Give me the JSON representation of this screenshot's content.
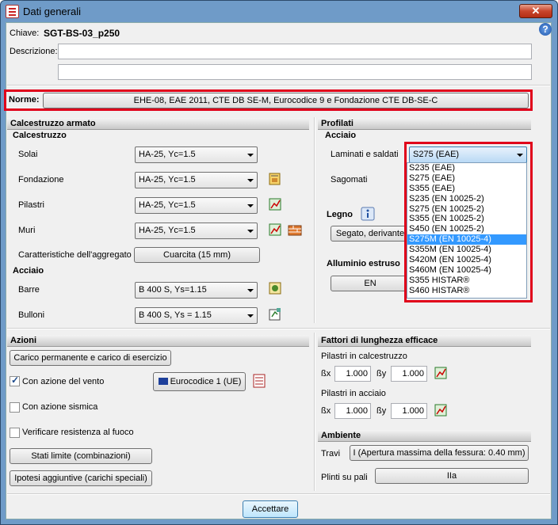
{
  "window": {
    "title": "Dati generali",
    "close": "✕"
  },
  "header": {
    "chiave_label": "Chiave:",
    "chiave_value": "SGT-BS-03_p250",
    "descrizione_label": "Descrizione:",
    "descr1": "",
    "descr2": ""
  },
  "norme": {
    "label": "Norme:",
    "value": "EHE-08, EAE 2011, CTE DB SE-M, Eurocodice 9 e Fondazione CTE DB-SE-C"
  },
  "calcestruzzo": {
    "section": "Calcestruzzo armato",
    "sub": "Calcestruzzo",
    "solai_label": "Solai",
    "solai": "HA-25, Yc=1.5",
    "fondazione_label": "Fondazione",
    "fondazione": "HA-25, Yc=1.5",
    "pilastri_label": "Pilastri",
    "pilastri": "HA-25, Yc=1.5",
    "muri_label": "Muri",
    "muri": "HA-25, Yc=1.5",
    "aggregato_label": "Caratteristiche dell'aggregato",
    "aggregato": "Cuarcita (15 mm)",
    "acciaio_sub": "Acciaio",
    "barre_label": "Barre",
    "barre": "B 400 S, Ys=1.15",
    "bulloni_label": "Bulloni",
    "bulloni": "B 400 S, Ys = 1.15"
  },
  "profilati": {
    "section": "Profilati",
    "sub": "Acciaio",
    "laminati_label": "Laminati e saldati",
    "laminati": "S275 (EAE)",
    "sagomati_label": "Sagomati",
    "legno_label": "Legno",
    "legno_btn": "Segato, derivante",
    "alluminio_label": "Alluminio estruso",
    "alluminio_btn": "EN",
    "options": [
      "S235 (EAE)",
      "S275 (EAE)",
      "S355 (EAE)",
      "S235 (EN 10025-2)",
      "S275 (EN 10025-2)",
      "S355 (EN 10025-2)",
      "S450 (EN 10025-2)",
      "S275M (EN 10025-4)",
      "S355M (EN 10025-4)",
      "S420M (EN 10025-4)",
      "S460M (EN 10025-4)",
      "S355 HISTAR®",
      "S460 HISTAR®"
    ]
  },
  "azioni": {
    "section": "Azioni",
    "carico_btn": "Carico permanente e carico di esercizio",
    "vento_label": "Con azione del vento",
    "vento_btn": "Eurocodice 1 (UE)",
    "sismica_label": "Con azione sismica",
    "fuoco_label": "Verificare resistenza al fuoco",
    "stati_btn": "Stati limite (combinazioni)",
    "ipotesi_btn": "Ipotesi aggiuntive (carichi speciali)"
  },
  "fattori": {
    "section": "Fattori di lunghezza efficace",
    "pil_calc_label": "Pilastri in calcestruzzo",
    "pil_acc_label": "Pilastri in acciaio",
    "bx": "ßx",
    "by": "ßy",
    "v1": "1.000",
    "v2": "1.000",
    "v3": "1.000",
    "v4": "1.000"
  },
  "ambiente": {
    "section": "Ambiente",
    "travi_label": "Travi",
    "travi_btn": "I (Apertura massima della fessura: 0.40 mm)",
    "plinti_label": "Plinti su pali",
    "plinti_btn": "IIa"
  },
  "footer": {
    "accept": "Accettare"
  }
}
